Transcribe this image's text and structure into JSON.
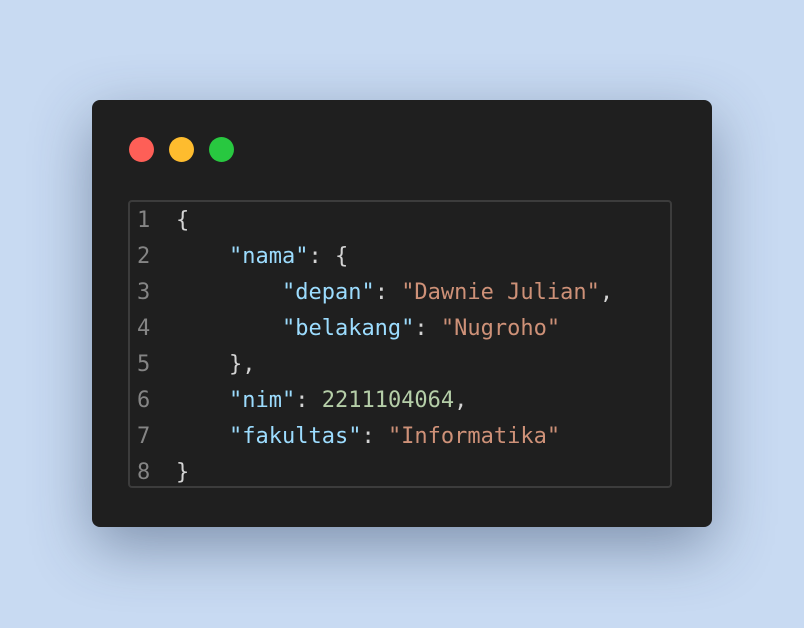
{
  "window": {
    "controls": [
      "close",
      "minimize",
      "maximize"
    ]
  },
  "code": {
    "lines": [
      {
        "num": "1",
        "indent": "",
        "tokens": [
          {
            "t": "punc",
            "v": "{"
          }
        ]
      },
      {
        "num": "2",
        "indent": "    ",
        "tokens": [
          {
            "t": "key",
            "v": "\"nama\""
          },
          {
            "t": "punc",
            "v": ": {"
          }
        ]
      },
      {
        "num": "3",
        "indent": "        ",
        "tokens": [
          {
            "t": "key",
            "v": "\"depan\""
          },
          {
            "t": "punc",
            "v": ": "
          },
          {
            "t": "str",
            "v": "\"Dawnie Julian\""
          },
          {
            "t": "punc",
            "v": ","
          }
        ]
      },
      {
        "num": "4",
        "indent": "        ",
        "tokens": [
          {
            "t": "key",
            "v": "\"belakang\""
          },
          {
            "t": "punc",
            "v": ": "
          },
          {
            "t": "str",
            "v": "\"Nugroho\""
          }
        ]
      },
      {
        "num": "5",
        "indent": "    ",
        "tokens": [
          {
            "t": "punc",
            "v": "},"
          }
        ]
      },
      {
        "num": "6",
        "indent": "    ",
        "tokens": [
          {
            "t": "key",
            "v": "\"nim\""
          },
          {
            "t": "punc",
            "v": ": "
          },
          {
            "t": "num",
            "v": "2211104064"
          },
          {
            "t": "punc",
            "v": ","
          }
        ]
      },
      {
        "num": "7",
        "indent": "    ",
        "tokens": [
          {
            "t": "key",
            "v": "\"fakultas\""
          },
          {
            "t": "punc",
            "v": ": "
          },
          {
            "t": "str",
            "v": "\"Informatika\""
          }
        ]
      },
      {
        "num": "8",
        "indent": "",
        "tokens": [
          {
            "t": "punc",
            "v": "}"
          }
        ]
      }
    ]
  },
  "colors": {
    "background": "#c8daf2",
    "window": "#1f1f1f",
    "close": "#fe5f57",
    "minimize": "#febc2e",
    "maximize": "#28c840",
    "key": "#9cdcfe",
    "string": "#ce9178",
    "number": "#b5cea8",
    "punctuation": "#d4d4d4",
    "line_number": "#858585"
  }
}
